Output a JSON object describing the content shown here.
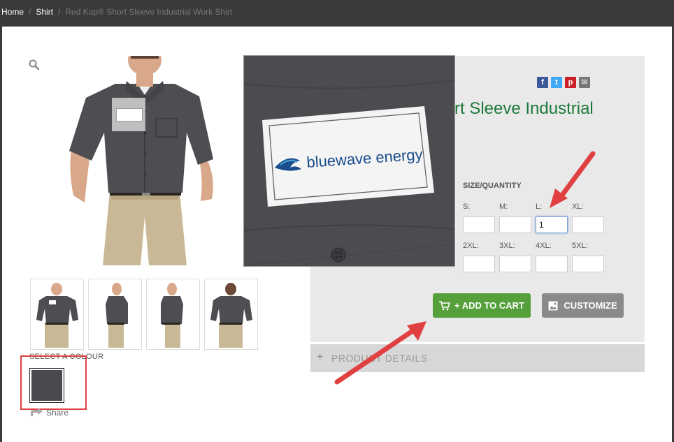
{
  "breadcrumb": {
    "home": "Home",
    "category": "Shirt",
    "current": "Red Kap® Short Sleeve Industrial Work Shirt"
  },
  "product": {
    "title_visible": "rt Sleeve Industrial",
    "zoom_logo_text": "bluewave energy"
  },
  "colour": {
    "label": "SELECT A COLOUR",
    "selected_hex": "#4a4a4e"
  },
  "share": {
    "label": "Share"
  },
  "social": {
    "facebook": "f",
    "twitter": "t",
    "pinterest": "p",
    "email": "✉"
  },
  "size_quantity": {
    "label": "SIZE/QUANTITY",
    "sizes": [
      {
        "label": "S:",
        "value": ""
      },
      {
        "label": "M:",
        "value": ""
      },
      {
        "label": "L:",
        "value": "1"
      },
      {
        "label": "XL:",
        "value": ""
      },
      {
        "label": "2XL:",
        "value": ""
      },
      {
        "label": "3XL:",
        "value": ""
      },
      {
        "label": "4XL:",
        "value": ""
      },
      {
        "label": "5XL:",
        "value": ""
      }
    ]
  },
  "buttons": {
    "add_to_cart": "+ ADD TO CART",
    "customize": "CUSTOMIZE"
  },
  "details": {
    "plus": "+",
    "label": "PRODUCT DETAILS"
  },
  "colors": {
    "title_green": "#1e7a3a",
    "add_cart_green": "#56a03b",
    "customize_gray": "#8a8a8a",
    "annotation_red": "#e04040"
  },
  "icons": {
    "zoom": "magnifier-icon",
    "cart": "shopping-cart-icon",
    "customize": "image-icon",
    "share": "share-icon"
  }
}
